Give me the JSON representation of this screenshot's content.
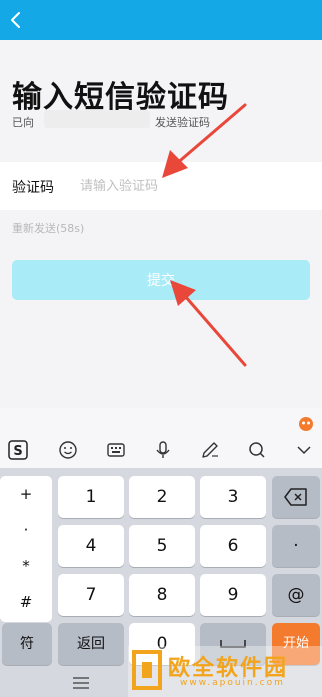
{
  "header": {
    "back_icon": "chevron-left-icon",
    "background": "#14a9e6"
  },
  "page": {
    "title": "输入短信验证码",
    "sent_prefix": "已向",
    "sent_suffix": "发送验证码"
  },
  "form": {
    "code_label": "验证码",
    "code_placeholder": "请输入验证码",
    "code_value": "",
    "resend_text": "重新发送(58s)",
    "submit_label": "提交",
    "submit_color": "#a9ecf7"
  },
  "keyboard": {
    "toolbar_icons": [
      "sogou-logo-icon",
      "emoji-icon",
      "keyboard-icon",
      "microphone-icon",
      "handwriting-icon",
      "search-icon",
      "chevron-down-icon"
    ],
    "symbols": [
      "+",
      "·",
      "*",
      "#"
    ],
    "digits": [
      "1",
      "2",
      "3",
      "4",
      "5",
      "6",
      "7",
      "8",
      "9",
      "0"
    ],
    "right_keys": [
      "backspace-icon",
      "·",
      "@"
    ],
    "bottom": {
      "symbols_label": "符",
      "back_label": "返回",
      "space_icon": "space-icon",
      "go_label": "开始",
      "go_color": "#f47a2d"
    }
  },
  "watermark": {
    "text": "欧全软件园",
    "url": "www.apouin.com"
  },
  "annotations": {
    "arrow_color": "#e8473a"
  }
}
